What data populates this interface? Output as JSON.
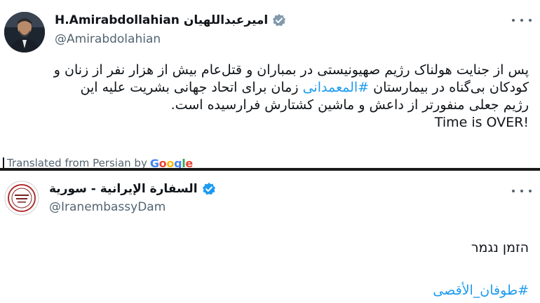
{
  "tweet1": {
    "display_name": "H.Amirabdollahian امیرعبداللهیان",
    "handle": "@Amirabdolahian",
    "text_lines": [
      "پس از جنایت هولناک رژیم صهیونیستی در بمباران و قتل‌عام بیش از هزار نفر از زنان و",
      "کودکان بی‌گناه در بیمارستان ",
      "زمان برای اتحاد جهانی بشریت علیه این",
      "رژیم جعلی منفورتر از داعش و ماشین کشتارش فرارسیده است."
    ],
    "hashtag": "#المعمدانی",
    "english_line": "Time is OVER!",
    "translated_label": "Translated from Persian by",
    "google_logo": "Google",
    "avatar_icon": "profile-photo",
    "verified_color": "#829aab"
  },
  "tweet2": {
    "display_name": "السفارة الإيرانية - سورية",
    "handle": "@IranembassyDam",
    "text": "הזמן נגמר",
    "hashtag": "#طوفان_الأقصى",
    "avatar_icon": "embassy-seal",
    "verified_color": "#1d9bf0"
  },
  "colors": {
    "text": "#0f1419",
    "secondary": "#536471",
    "link": "#1d9bf0",
    "separator": "#1a1a1a"
  }
}
